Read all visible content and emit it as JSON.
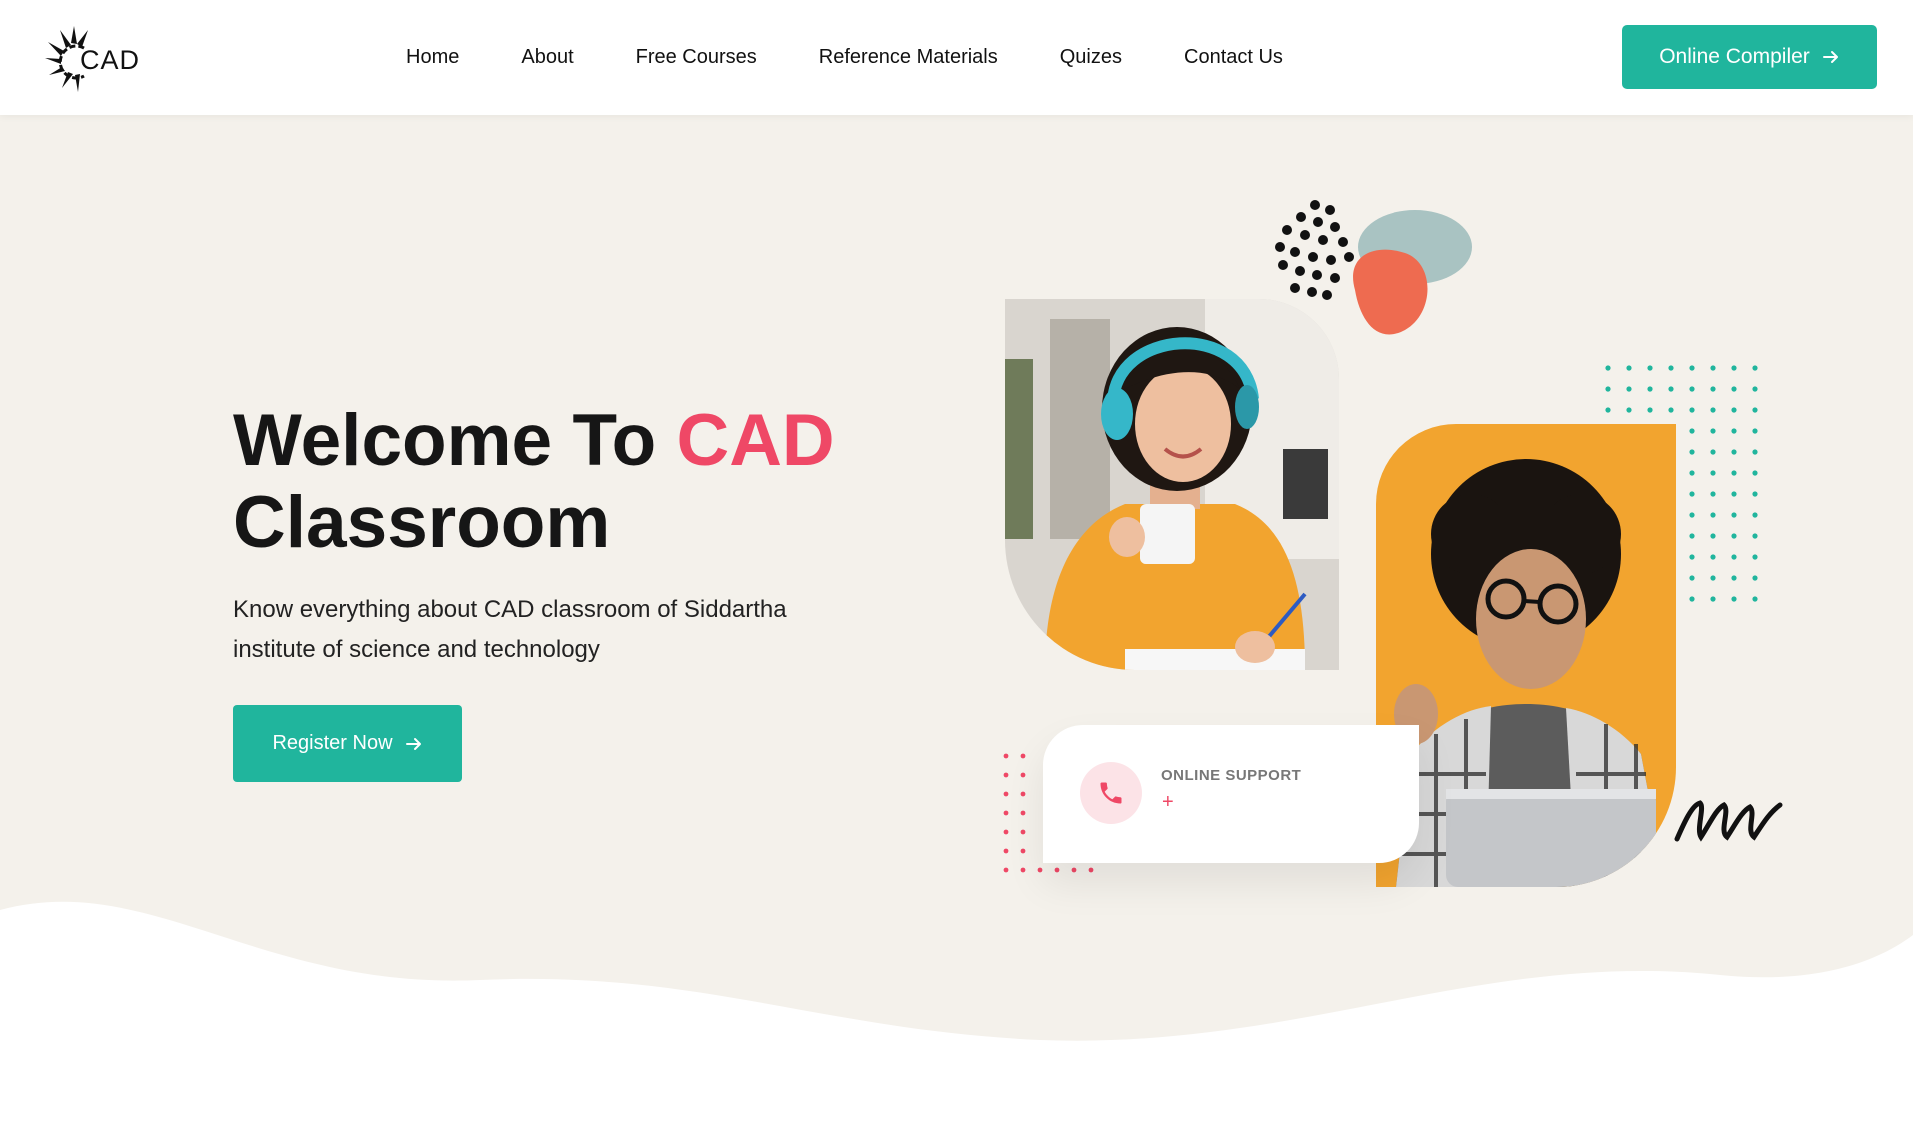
{
  "header": {
    "logo_text": "CAD",
    "nav": [
      "Home",
      "About",
      "Free Courses",
      "Reference Materials",
      "Quizes",
      "Contact Us"
    ],
    "cta_label": "Online Compiler"
  },
  "hero": {
    "title_part1": "Welcome To ",
    "title_accent": "CAD",
    "title_part2": "Classroom",
    "subtitle": "Know everything about CAD classroom of Siddartha institute of science and technology",
    "register_label": "Register Now",
    "support_label": "ONLINE SUPPORT",
    "support_value": "+"
  },
  "icons": [
    "sunburst-logo-icon",
    "arrow-right-icon",
    "phone-icon"
  ],
  "colors": {
    "accent_teal": "#20b59d",
    "accent_pink": "#ef4866",
    "hero_bg": "#f4f1eb",
    "photo_orange": "#f2a42f",
    "blob_coral": "#ee6b50",
    "blob_sage": "#a9c3c2"
  }
}
